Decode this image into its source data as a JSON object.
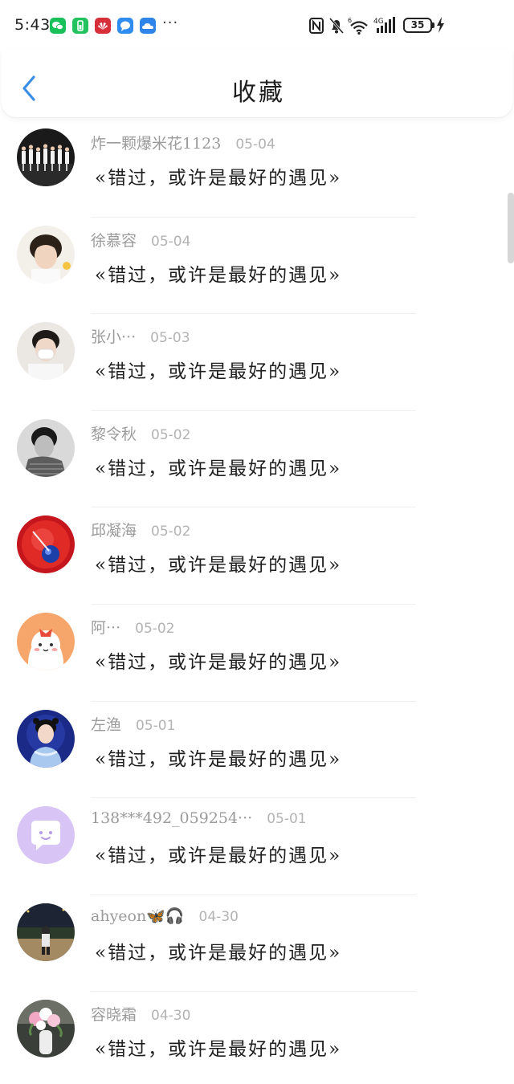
{
  "status_bar": {
    "time": "5:43",
    "battery": "35",
    "apps": [
      "wechat-icon",
      "battery-app-icon",
      "huawei-icon",
      "message-icon",
      "cloud-icon"
    ],
    "more": "···"
  },
  "header": {
    "title": "收藏",
    "back_icon": "chevron-left-icon"
  },
  "colors": {
    "accent": "#3a8ee6",
    "title": "#1f1f1f",
    "meta": "#9b9b9b",
    "date": "#b3b3b3"
  },
  "favorites": [
    {
      "user": "炸一颗爆米花1123",
      "date": "05-04",
      "title": "«错过，或许是最好的遇见»"
    },
    {
      "user": "徐慕容",
      "date": "05-04",
      "title": "«错过，或许是最好的遇见»"
    },
    {
      "user": "张小···",
      "date": "05-03",
      "title": "«错过，或许是最好的遇见»"
    },
    {
      "user": "黎令秋",
      "date": "05-02",
      "title": "«错过，或许是最好的遇见»"
    },
    {
      "user": "邱凝海",
      "date": "05-02",
      "title": "«错过，或许是最好的遇见»"
    },
    {
      "user": "阿···",
      "date": "05-02",
      "title": "«错过，或许是最好的遇见»"
    },
    {
      "user": "左渔",
      "date": "05-01",
      "title": "«错过，或许是最好的遇见»"
    },
    {
      "user": "138***492_059254···",
      "date": "05-01",
      "title": "«错过，或许是最好的遇见»"
    },
    {
      "user": "ahyeon🦋🎧",
      "date": "04-30",
      "title": "«错过，或许是最好的遇见»"
    },
    {
      "user": "容晓霜",
      "date": "04-30",
      "title": "«错过，或许是最好的遇见»"
    }
  ]
}
